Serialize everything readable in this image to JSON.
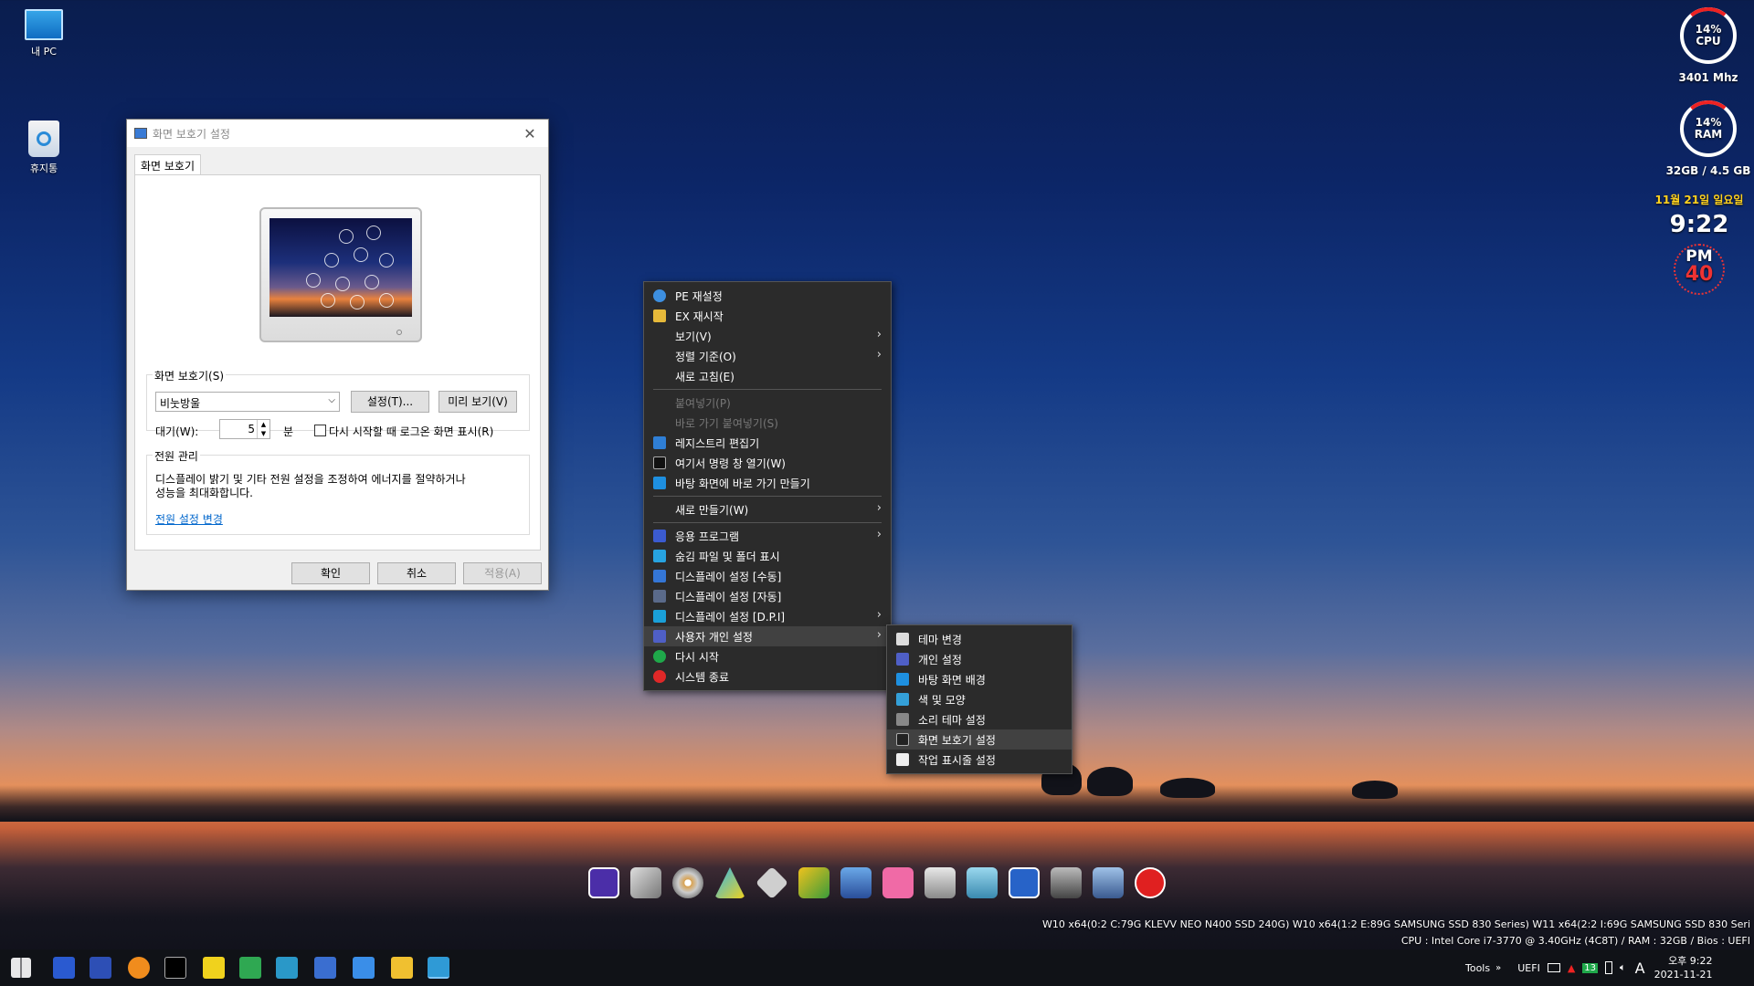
{
  "desktop": {
    "icons": [
      {
        "label": "내 PC"
      },
      {
        "label": "휴지통"
      }
    ]
  },
  "gadgets": {
    "cpu": {
      "percent": "14%",
      "label": "CPU",
      "freq": "3401 Mhz"
    },
    "ram": {
      "percent": "14%",
      "label": "RAM",
      "usage": "32GB / 4.5 GB"
    },
    "clock": {
      "date": "11월 21일 일요일",
      "time": "9:22",
      "ampm": "PM",
      "seconds": "40"
    }
  },
  "dialog": {
    "title": "화면 보호기 설정",
    "tab": "화면 보호기",
    "screensaver_group": "화면 보호기(S)",
    "screensaver_value": "비눗방울",
    "settings_button": "설정(T)...",
    "preview_button": "미리 보기(V)",
    "wait_label": "대기(W):",
    "wait_value": "5",
    "minutes_label": "분",
    "logon_checkbox": "다시 시작할 때 로그온 화면 표시(R)",
    "power_group": "전원 관리",
    "power_desc_1": "디스플레이 밝기 및 기타 전원 설정을 조정하여 에너지를 절약하거나",
    "power_desc_2": "성능을 최대화합니다.",
    "power_link": "전원 설정 변경",
    "ok": "확인",
    "cancel": "취소",
    "apply": "적용(A)"
  },
  "context_menu": {
    "items": [
      {
        "label": "PE 재설정"
      },
      {
        "label": "EX 재시작"
      },
      {
        "label": "보기(V)"
      },
      {
        "label": "정렬 기준(O)"
      },
      {
        "label": "새로 고침(E)"
      },
      {
        "label": "붙여넣기(P)"
      },
      {
        "label": "바로 가기 붙여넣기(S)"
      },
      {
        "label": "레지스트리 편집기"
      },
      {
        "label": "여기서 명령 창 열기(W)"
      },
      {
        "label": "바탕 화면에 바로 가기 만들기"
      },
      {
        "label": "새로 만들기(W)"
      },
      {
        "label": "응용 프로그램"
      },
      {
        "label": "숨김 파일 및 폴더 표시"
      },
      {
        "label": "디스플레이 설정 [수동]"
      },
      {
        "label": "디스플레이 설정 [자동]"
      },
      {
        "label": "디스플레이 설정 [D.P.I]"
      },
      {
        "label": "사용자 개인 설정"
      },
      {
        "label": "다시 시작"
      },
      {
        "label": "시스템 종료"
      }
    ]
  },
  "submenu": {
    "items": [
      {
        "label": "테마 변경"
      },
      {
        "label": "개인 설정"
      },
      {
        "label": "바탕 화면 배경"
      },
      {
        "label": "색 및 모양"
      },
      {
        "label": "소리 테마 설정"
      },
      {
        "label": "화면 보호기 설정"
      },
      {
        "label": "작업 표시줄 설정"
      }
    ]
  },
  "sysinfo": {
    "line1": "W10  x64(0:2 C:79G KLEVV NEO N400 SSD 240G) W10  x64(1:2 E:89G SAMSUNG SSD 830 Series) W11  x64(2:2 I:69G SAMSUNG SSD 830 Seri",
    "line2": "CPU : Intel Core i7-3770 @ 3.40GHz (4C8T) / RAM : 32GB / Bios : UEFI"
  },
  "taskbar": {
    "tools": "Tools",
    "uefi": "UEFI",
    "tray_badge": "13",
    "ime": "A",
    "time": "오후 9:22",
    "date": "2021-11-21"
  },
  "colors": {
    "menu_bg": "#2b2b2b",
    "taskbar_bg": "#101217",
    "accent_red": "#e22222",
    "date_yellow": "#ffd21f"
  }
}
